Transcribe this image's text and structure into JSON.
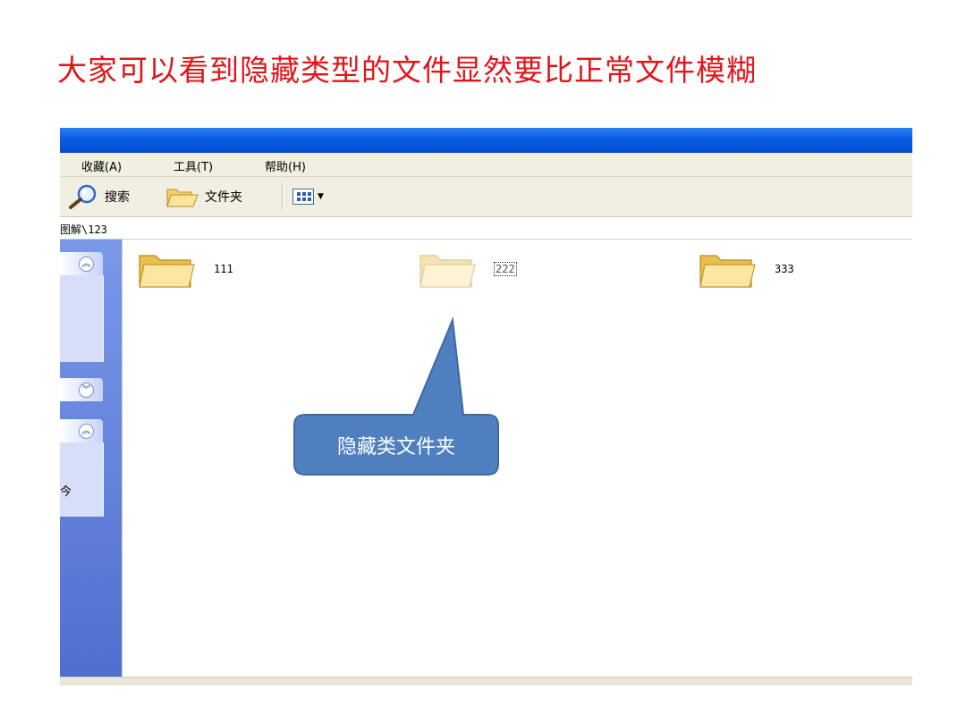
{
  "slide": {
    "title": "大家可以看到隐藏类型的文件显然要比正常文件模糊"
  },
  "window": {
    "menu": [
      "收藏(A)",
      "工具(T)",
      "帮助(H)"
    ],
    "toolbar": {
      "search_label": "搜索",
      "folders_label": "文件夹",
      "view_icon": "views-icon"
    },
    "address": "图解\\123",
    "sidebar": {
      "cut_text": "今"
    },
    "folders": [
      {
        "name": "111",
        "hidden": false
      },
      {
        "name": "222",
        "hidden": true
      },
      {
        "name": "333",
        "hidden": false
      }
    ]
  },
  "callout": {
    "text": "隐藏类文件夹",
    "fill": "#4f7fbf",
    "stroke": "#3f6aa0"
  },
  "colors": {
    "title": "#e0161a",
    "titlebar": "#0a5be0",
    "chrome": "#f1efe2",
    "sidebar": "#6080da"
  }
}
